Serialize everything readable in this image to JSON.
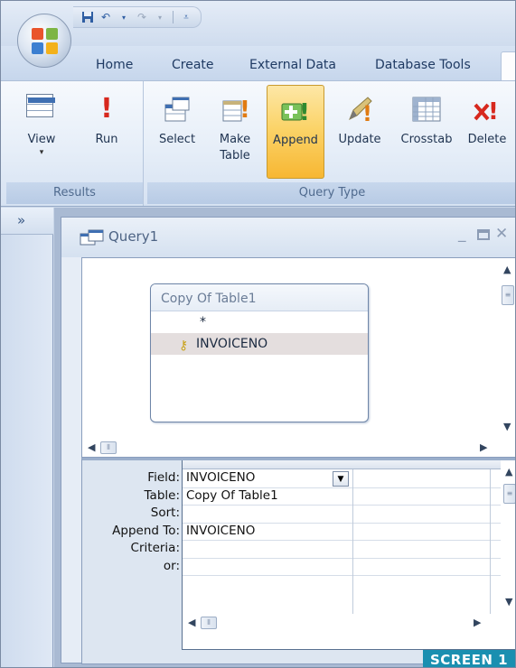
{
  "quick_access": {
    "save_icon": "save-icon",
    "undo_icon": "undo-icon",
    "redo_icon": "redo-icon",
    "customize_icon": "customize-qat-icon"
  },
  "tabs": [
    {
      "label": "Home"
    },
    {
      "label": "Create"
    },
    {
      "label": "External Data"
    },
    {
      "label": "Database Tools"
    }
  ],
  "ribbon": {
    "results_group": {
      "label": "Results",
      "view_label": "View",
      "run_label": "Run"
    },
    "query_type_group": {
      "label": "Query Type",
      "select_label": "Select",
      "make_table_label_1": "Make",
      "make_table_label_2": "Table",
      "append_label": "Append",
      "update_label": "Update",
      "crosstab_label": "Crosstab",
      "delete_label": "Delete"
    }
  },
  "nav_pane": {
    "toggle_label": "»"
  },
  "query_window": {
    "title": "Query1",
    "table": {
      "name": "Copy Of Table1",
      "fields": [
        "*",
        "INVOICENO"
      ]
    },
    "grid": {
      "row_labels": [
        "Field:",
        "Table:",
        "Sort:",
        "Append To:",
        "Criteria:",
        "or:"
      ],
      "column1": {
        "field": "INVOICENO",
        "table": "Copy Of Table1",
        "sort": "",
        "append_to": "INVOICENO",
        "criteria": "",
        "or": ""
      }
    }
  },
  "badge": {
    "label": "SCREEN 1"
  },
  "colors": {
    "append_highlight": "#fbd46a",
    "badge_bg": "#1a8fb0",
    "key_row": "#e4dede"
  }
}
